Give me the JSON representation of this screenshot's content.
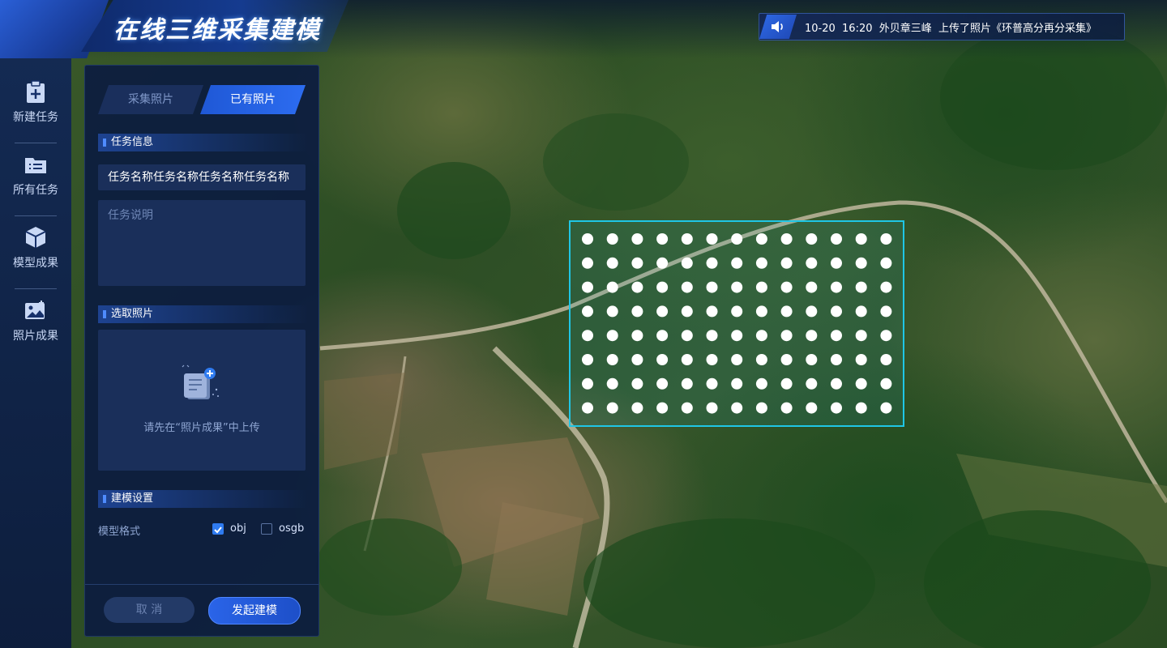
{
  "header": {
    "app_title": "在线三维采集建模",
    "notice": "10-20  16:20  外贝章三峰  上传了照片《环普高分再分采集》"
  },
  "rail": {
    "items": [
      {
        "label": "新建任务",
        "icon": "clipboard-plus-icon"
      },
      {
        "label": "所有任务",
        "icon": "folder-list-icon"
      },
      {
        "label": "模型成果",
        "icon": "cube-icon"
      },
      {
        "label": "照片成果",
        "icon": "images-icon"
      }
    ]
  },
  "panel": {
    "tabs": [
      {
        "label": "采集照片",
        "active": false
      },
      {
        "label": "已有照片",
        "active": true
      }
    ],
    "task_info": {
      "section_title": "任务信息",
      "name_value": "任务名称任务名称任务名称任务名称",
      "desc_placeholder": "任务说明"
    },
    "select_photos": {
      "section_title": "选取照片",
      "hint": "请先在“照片成果”中上传"
    },
    "modeling": {
      "section_title": "建模设置",
      "format_label": "模型格式",
      "options": [
        {
          "label": "obj",
          "checked": true
        },
        {
          "label": "osgb",
          "checked": false
        }
      ]
    },
    "buttons": {
      "cancel": "取 消",
      "start": "发起建模"
    }
  },
  "map": {
    "selection_grid": {
      "rows": 8,
      "cols": 13
    },
    "colors": {
      "selection_border": "#1fc6e6",
      "dot": "#ffffff",
      "accent": "#2c6cf0"
    }
  }
}
